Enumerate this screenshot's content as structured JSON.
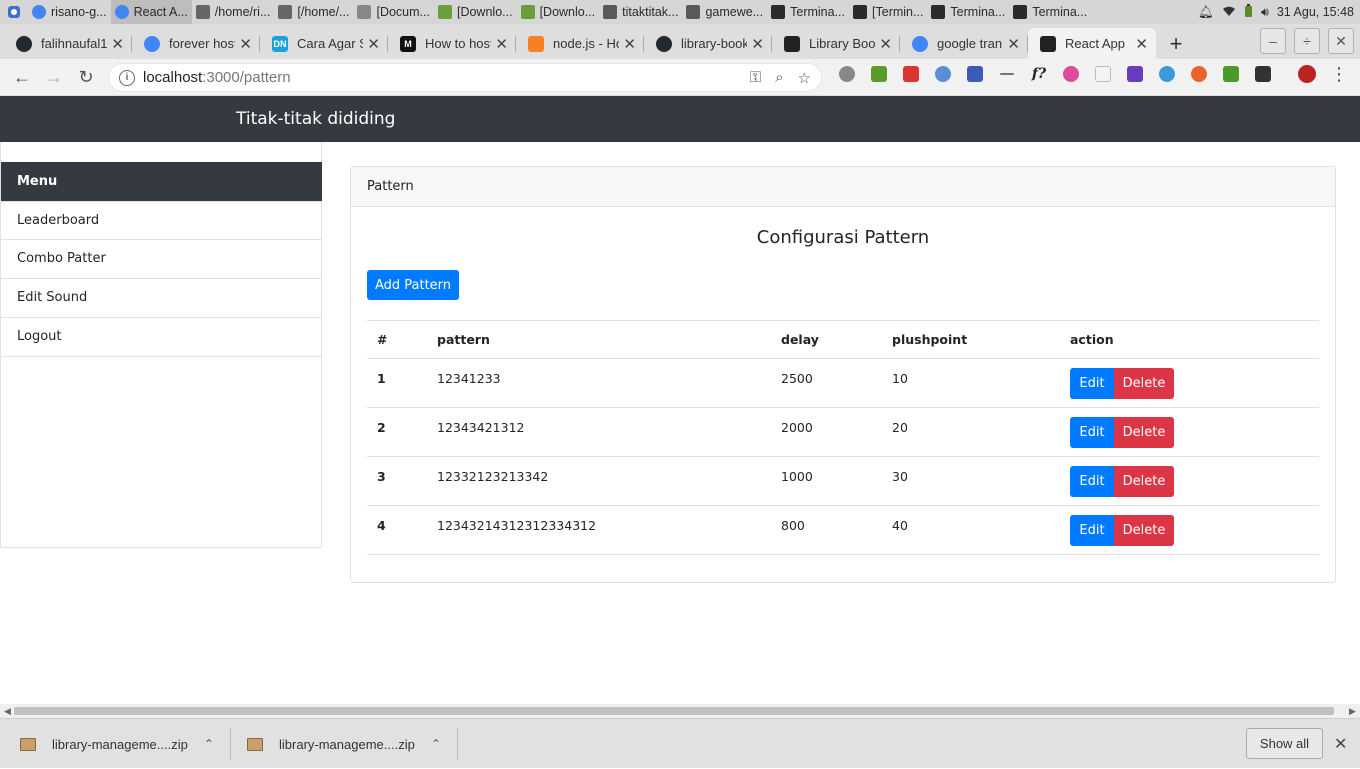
{
  "taskbar": {
    "items": [
      {
        "label": "risano-g...",
        "color": "#4285f4",
        "icon": "chrome-icon"
      },
      {
        "label": "React A...",
        "color": "#4285f4",
        "icon": "chrome-icon"
      },
      {
        "label": "/home/ri...",
        "color": "#666666",
        "icon": "editor-icon"
      },
      {
        "label": "[/home/...",
        "color": "#666666",
        "icon": "editor-icon"
      },
      {
        "label": "[Docum...",
        "color": "#888888",
        "icon": "document-icon"
      },
      {
        "label": "[Downlo...",
        "color": "#6a9e3a",
        "icon": "download-icon"
      },
      {
        "label": "[Downlo...",
        "color": "#6a9e3a",
        "icon": "download-icon"
      },
      {
        "label": "titaktitak...",
        "color": "#5a5a5a",
        "icon": "folder-icon"
      },
      {
        "label": "gamewe...",
        "color": "#5a5a5a",
        "icon": "folder-icon"
      },
      {
        "label": "Termina...",
        "color": "#2b2b2b",
        "icon": "terminal-icon"
      },
      {
        "label": "[Termin...",
        "color": "#2b2b2b",
        "icon": "terminal-icon"
      },
      {
        "label": "Termina...",
        "color": "#2b2b2b",
        "icon": "terminal-icon"
      },
      {
        "label": "Termina...",
        "color": "#2b2b2b",
        "icon": "terminal-icon"
      }
    ],
    "clock": "31 Agu, 15:48"
  },
  "tabs": [
    {
      "title": "falihnaufal1",
      "favicon": "github-icon",
      "color": "#24292e"
    },
    {
      "title": "forever host",
      "favicon": "google-icon",
      "color": "#4285f4"
    },
    {
      "title": "Cara Agar S",
      "favicon": "dn-icon",
      "color": "#1aa3d9",
      "glyph": "DN"
    },
    {
      "title": "How to host",
      "favicon": "medium-icon",
      "color": "#111111",
      "glyph": "M"
    },
    {
      "title": "node.js - Ho",
      "favicon": "stackoverflow-icon",
      "color": "#f48024"
    },
    {
      "title": "library-book",
      "favicon": "github-icon",
      "color": "#24292e"
    },
    {
      "title": "Library Boo",
      "favicon": "react-icon",
      "color": "#222222"
    },
    {
      "title": "google tran",
      "favicon": "google-icon",
      "color": "#4285f4"
    },
    {
      "title": "React App",
      "favicon": "react-icon",
      "color": "#222222",
      "active": true
    }
  ],
  "address": {
    "host": "localhost",
    "path": ":3000/pattern"
  },
  "app": {
    "brand": "Titak-titak dididing",
    "menu_title": "Menu",
    "menu": [
      "Leaderboard",
      "Combo Patter",
      "Edit Sound",
      "Logout"
    ],
    "card_header": "Pattern",
    "card_title": "Configurasi Pattern",
    "add_button": "Add Pattern",
    "columns": [
      "#",
      "pattern",
      "delay",
      "plushpoint",
      "action"
    ],
    "rows": [
      {
        "no": "1",
        "pattern": "12341233",
        "delay": "2500",
        "point": "10"
      },
      {
        "no": "2",
        "pattern": "12343421312",
        "delay": "2000",
        "point": "20"
      },
      {
        "no": "3",
        "pattern": "12332123213342",
        "delay": "1000",
        "point": "30"
      },
      {
        "no": "4",
        "pattern": "12343214312312334312",
        "delay": "800",
        "point": "40"
      }
    ],
    "edit_label": "Edit",
    "delete_label": "Delete"
  },
  "downloads": {
    "items": [
      "library-manageme....zip",
      "library-manageme....zip"
    ],
    "show_all": "Show all"
  },
  "colors": {
    "navbar": "#343a40",
    "primary": "#007bff",
    "danger": "#dc3545"
  }
}
